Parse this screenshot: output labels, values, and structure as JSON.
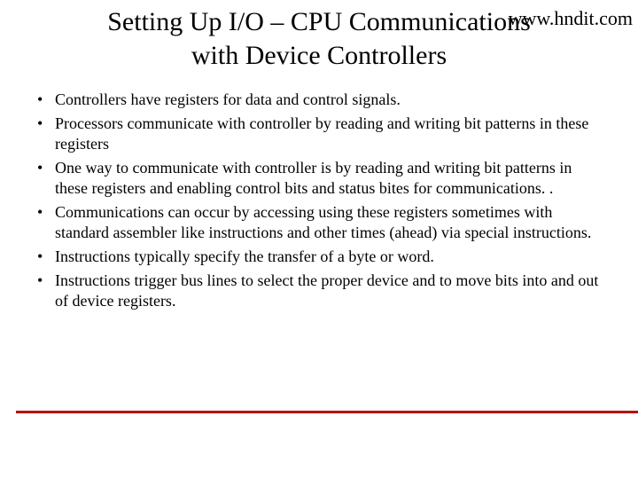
{
  "watermark": "www.hndit.com",
  "title_line1": "Setting Up I/O – CPU Communications",
  "title_line2": "with Device Controllers",
  "bullets": [
    "Controllers have registers for data and control signals.",
    "Processors communicate with controller by reading and writing bit patterns in these registers",
    "One way to communicate with controller is by reading and writing bit patterns in these registers and enabling control bits and status bites for communications. .",
    "Communications can occur by accessing using these registers sometimes with standard assembler like instructions and other times (ahead) via special instructions.",
    "Instructions typically specify the transfer of a byte or word.",
    "Instructions trigger bus lines to select the proper device and to move bits into and out of device registers."
  ]
}
